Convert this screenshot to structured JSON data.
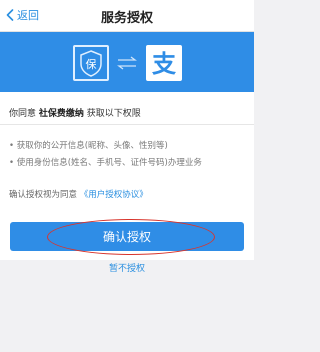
{
  "navbar": {
    "back_label": "返回",
    "title": "服务授权"
  },
  "banner": {
    "left_logo_char": "保",
    "right_logo_char": "支"
  },
  "consent": {
    "prefix": "你同意",
    "app_name": "社保费缴纳",
    "suffix": "获取以下权限"
  },
  "permissions": [
    "• 获取你的公开信息(昵称、头像、性别等)",
    "• 使用身份信息(姓名、手机号、证件号码)办理业务"
  ],
  "agreement": {
    "prefix": "确认授权视为同意",
    "link": "《用户授权协议》"
  },
  "buttons": {
    "confirm": "确认授权",
    "later": "暂不授权"
  },
  "colors": {
    "brand_blue": "#2f8de6",
    "link_blue": "#2a8fe0",
    "annotation_red": "#d8352d"
  }
}
